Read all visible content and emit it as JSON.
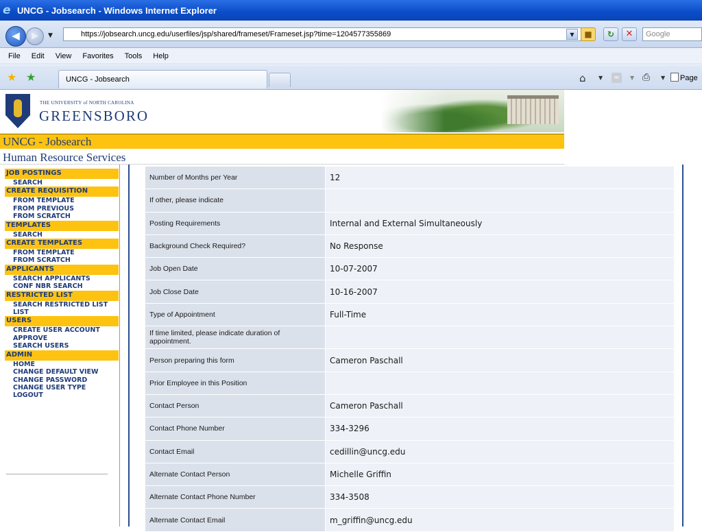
{
  "window": {
    "title": "UNCG - Jobsearch - Windows Internet Explorer"
  },
  "address_bar": {
    "url": "https://jobsearch.uncg.edu/userfiles/jsp/shared/frameset/Frameset.jsp?time=1204577355869",
    "search_placeholder": "Google"
  },
  "menu": [
    "File",
    "Edit",
    "View",
    "Favorites",
    "Tools",
    "Help"
  ],
  "tabs": {
    "active_label": "UNCG - Jobsearch",
    "page_label": "Page"
  },
  "header": {
    "university_small": "THE UNIVERSITY of NORTH CAROLINA",
    "university_big": "GREENSBORO",
    "app_title": "UNCG - Jobsearch",
    "department": "Human Resource Services"
  },
  "sidebar": [
    {
      "section": "JOB POSTINGS",
      "links": [
        "SEARCH"
      ]
    },
    {
      "section": "CREATE REQUISITION",
      "links": [
        "FROM TEMPLATE",
        "FROM PREVIOUS",
        "FROM SCRATCH"
      ]
    },
    {
      "section": "TEMPLATES",
      "links": [
        "SEARCH"
      ]
    },
    {
      "section": "CREATE TEMPLATES",
      "links": [
        "FROM TEMPLATE",
        "FROM SCRATCH"
      ]
    },
    {
      "section": "APPLICANTS",
      "links": [
        "SEARCH APPLICANTS",
        "CONF NBR SEARCH"
      ]
    },
    {
      "section": "RESTRICTED LIST",
      "links": [
        "SEARCH RESTRICTED LIST",
        "LIST"
      ]
    },
    {
      "section": "USERS",
      "links": [
        "CREATE USER ACCOUNT",
        "APPROVE",
        "SEARCH USERS"
      ]
    },
    {
      "section": "ADMIN",
      "links": [
        "HOME",
        "CHANGE DEFAULT VIEW",
        "CHANGE PASSWORD",
        "CHANGE USER TYPE",
        "LOGOUT"
      ]
    }
  ],
  "form_rows": [
    {
      "label": "Number of Months per Year",
      "value": "12"
    },
    {
      "label": "If other, please indicate",
      "value": ""
    },
    {
      "label": "Posting Requirements",
      "value": "Internal and External Simultaneously"
    },
    {
      "label": "Background Check Required?",
      "value": "No Response"
    },
    {
      "label": "Job Open Date",
      "value": "10-07-2007"
    },
    {
      "label": "Job Close Date",
      "value": "10-16-2007"
    },
    {
      "label": "Type of Appointment",
      "value": "Full-Time"
    },
    {
      "label": "If time limited, please indicate duration of appointment.",
      "value": ""
    },
    {
      "label": "Person preparing this form",
      "value": "Cameron Paschall"
    },
    {
      "label": "Prior Employee in this Position",
      "value": ""
    },
    {
      "label": "Contact Person",
      "value": "Cameron Paschall"
    },
    {
      "label": "Contact Phone Number",
      "value": "334-3296"
    },
    {
      "label": "Contact Email",
      "value": "cedillin@uncg.edu"
    },
    {
      "label": "Alternate Contact Person",
      "value": "Michelle Griffin"
    },
    {
      "label": "Alternate Contact Phone Number",
      "value": "334-3508"
    },
    {
      "label": "Alternate Contact Email",
      "value": "m_griffin@uncg.edu"
    }
  ]
}
